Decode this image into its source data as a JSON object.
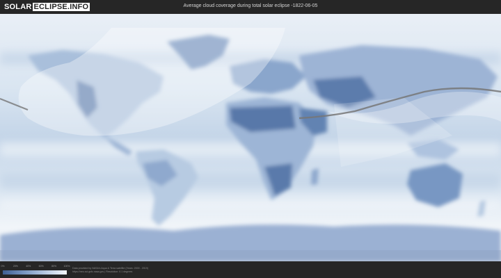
{
  "header": {
    "logo_part1": "SOLAR",
    "logo_part2": "ECLIPSE.INFO",
    "title": "Average cloud coverage during total solar eclipse -1822-06-05"
  },
  "legend": {
    "ticks": [
      "0%",
      "20%",
      "40%",
      "60%",
      "80%",
      "100%"
    ],
    "colors": [
      "#3f5f92",
      "#6a88b6",
      "#97afd1",
      "#c6d5e8",
      "#f4f7fb"
    ]
  },
  "footer": {
    "credit_line1": "Data provided by NASA's Aqua & Terra satellite (Years: 2000 - 2019)",
    "credit_line2": "https://neo.sci.gsfc.nasa.gov | Resolution: 0.1 degrees"
  },
  "map": {
    "ocean_color": "#dfe9f3",
    "land_dark_color": "#5d7eaf",
    "eclipse_path_color": "#777777"
  }
}
